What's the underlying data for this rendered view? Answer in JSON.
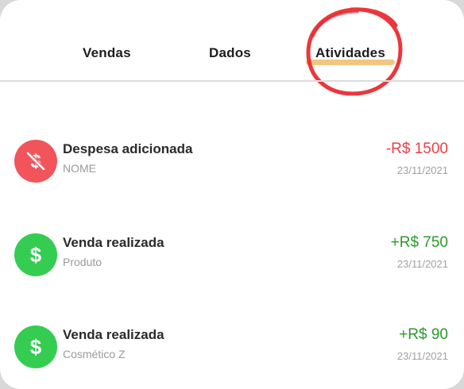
{
  "tabs": [
    {
      "label": "Vendas"
    },
    {
      "label": "Dados"
    },
    {
      "label": "Atividades",
      "active": true
    }
  ],
  "colors": {
    "expense": "#ef3e45",
    "income": "#2a9a2a",
    "avatar_expense": "#f2545b",
    "avatar_income": "#35cc52",
    "active_underline": "#f0c781",
    "highlight_circle": "#e8262b"
  },
  "activities": [
    {
      "icon": "no-money-icon",
      "title": "Despesa adicionada",
      "subtitle": "NOME",
      "amount": "-R$ 1500",
      "date": "23/11/2021",
      "type": "expense"
    },
    {
      "icon": "dollar-icon",
      "title": "Venda realizada",
      "subtitle": "Produto",
      "amount": "+R$ 750",
      "date": "23/11/2021",
      "type": "income"
    },
    {
      "icon": "dollar-icon",
      "title": "Venda realizada",
      "subtitle": "Cosmético Z",
      "amount": "+R$ 90",
      "date": "23/11/2021",
      "type": "income"
    }
  ]
}
